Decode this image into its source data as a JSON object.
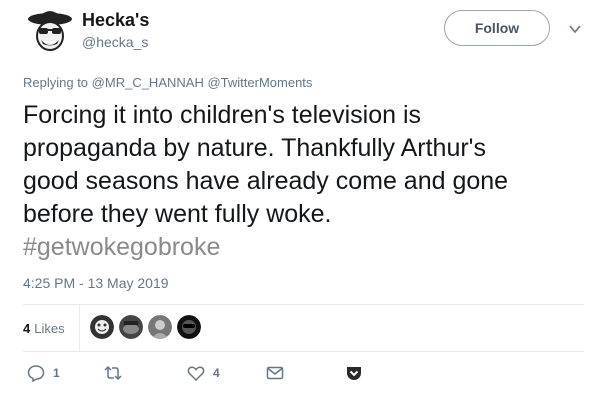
{
  "author": {
    "display_name": "Hecka's",
    "handle": "@hecka_s",
    "avatar_icon": "cartoon-cowboy-avatar"
  },
  "follow_label": "Follow",
  "reply": {
    "prefix": "Replying to",
    "mentions": [
      "@MR_C_HANNAH",
      "@TwitterMoments"
    ]
  },
  "tweet": {
    "lines": [
      "Forcing it into children's television is",
      "propaganda by nature. Thankfully Arthur's",
      "good seasons have already come and gone",
      "before they went fully woke."
    ],
    "hashtag": "#getwokegobroke"
  },
  "timestamp": "4:25 PM - 13 May 2019",
  "likes": {
    "count": "4",
    "label": "Likes"
  },
  "likers": [
    "liker-avatar-1",
    "liker-avatar-2",
    "liker-avatar-3",
    "liker-avatar-4"
  ],
  "actions": {
    "reply_count": "1",
    "retweet_count": "",
    "like_count": "4"
  },
  "colors": {
    "text": "#14171a",
    "secondary": "#657786",
    "divider": "#e6ecf0"
  }
}
